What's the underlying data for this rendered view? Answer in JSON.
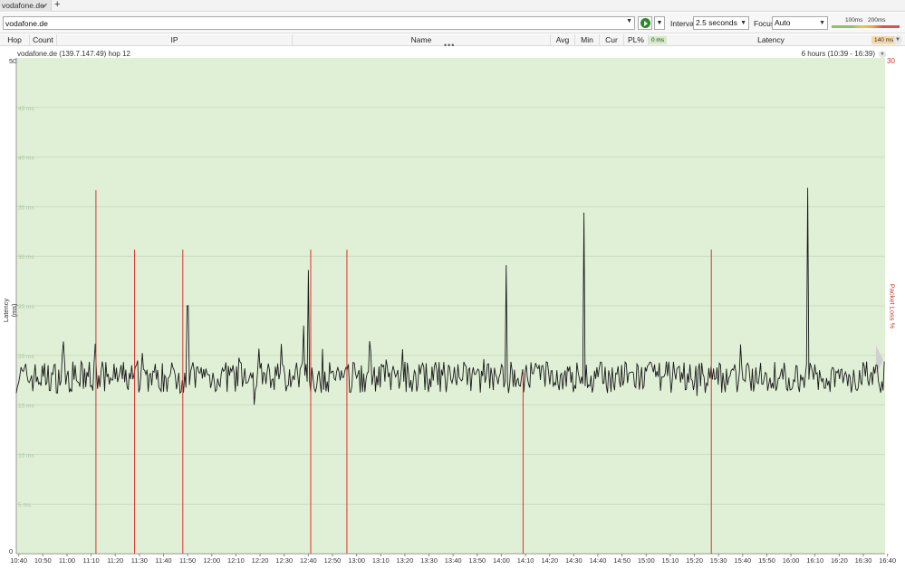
{
  "tabs": [
    {
      "label": "vodafone.de",
      "close": "✔"
    }
  ],
  "add_tab_label": "+",
  "toolbar": {
    "target_value": "vodafone.de",
    "interval_label": "Interval",
    "interval_value": "2.5 seconds",
    "focus_label": "Focus",
    "focus_value": "Auto",
    "scale_label_1": "100ms",
    "scale_label_2": "200ms"
  },
  "columns": {
    "hop": "Hop",
    "count": "Count",
    "ip": "IP",
    "name": "Name",
    "avg": "Avg",
    "min": "Min",
    "cur": "Cur",
    "pl": "PL%",
    "latency": "Latency",
    "badge_min": "0 ms",
    "badge_max": "140 ms"
  },
  "graph": {
    "title": "vodafone.de (139.7.147.49) hop 12",
    "range": "6 hours (10:39 - 16:39)",
    "y_axis_title": "Latency (ms)",
    "y2_axis_title": "Packet Loss %",
    "y2_max_label": "30",
    "colors": {
      "background": "#e0f0d7",
      "line": "#1a1a1a",
      "loss": "#e03030",
      "grid": "#c9ddbf"
    }
  },
  "chart_data": {
    "type": "line",
    "title": "vodafone.de (139.7.147.49) hop 12",
    "ylabel": "Latency (ms)",
    "y2label": "Packet Loss %",
    "ylim": [
      0,
      50
    ],
    "y2lim": [
      0,
      30
    ],
    "y_ticks": [
      0,
      5,
      10,
      15,
      20,
      25,
      30,
      35,
      40,
      45,
      50
    ],
    "y_tick_labels": [
      "0",
      "5 ms",
      "10 ms",
      "15 ms",
      "20 ms",
      "25 ms",
      "30 ms",
      "35 ms",
      "40 ms",
      "45 ms",
      "50"
    ],
    "x_tick_labels": [
      "10:40",
      "10:50",
      "11:00",
      "11:10",
      "11:20",
      "11:30",
      "11:40",
      "11:50",
      "12:00",
      "12:10",
      "12:20",
      "12:30",
      "12:40",
      "12:50",
      "13:00",
      "13:10",
      "13:20",
      "13:30",
      "13:40",
      "13:50",
      "14:00",
      "14:10",
      "14:20",
      "14:30",
      "14:40",
      "14:50",
      "15:00",
      "15:10",
      "15:20",
      "15:30",
      "15:40",
      "15:50",
      "16:00",
      "16:10",
      "16:20",
      "16:30",
      "16:40"
    ],
    "x_range": [
      "10:39",
      "16:39"
    ],
    "latency_baseline_ms": 17.8,
    "latency_spikes": [
      {
        "time": "11:50",
        "ms": 25
      },
      {
        "time": "12:38",
        "ms": 23
      },
      {
        "time": "12:40",
        "ms": 28.6
      },
      {
        "time": "14:02",
        "ms": 29.1
      },
      {
        "time": "14:34",
        "ms": 34.4
      },
      {
        "time": "16:07",
        "ms": 36.9
      }
    ],
    "loss_events": [
      {
        "time": "11:12",
        "pct": 22
      },
      {
        "time": "11:28",
        "pct": 18.4
      },
      {
        "time": "11:48",
        "pct": 18.4
      },
      {
        "time": "12:41",
        "pct": 18.4
      },
      {
        "time": "12:56",
        "pct": 18.4
      },
      {
        "time": "14:09",
        "pct": 11
      },
      {
        "time": "15:27",
        "pct": 18.4
      }
    ],
    "grid": true
  }
}
